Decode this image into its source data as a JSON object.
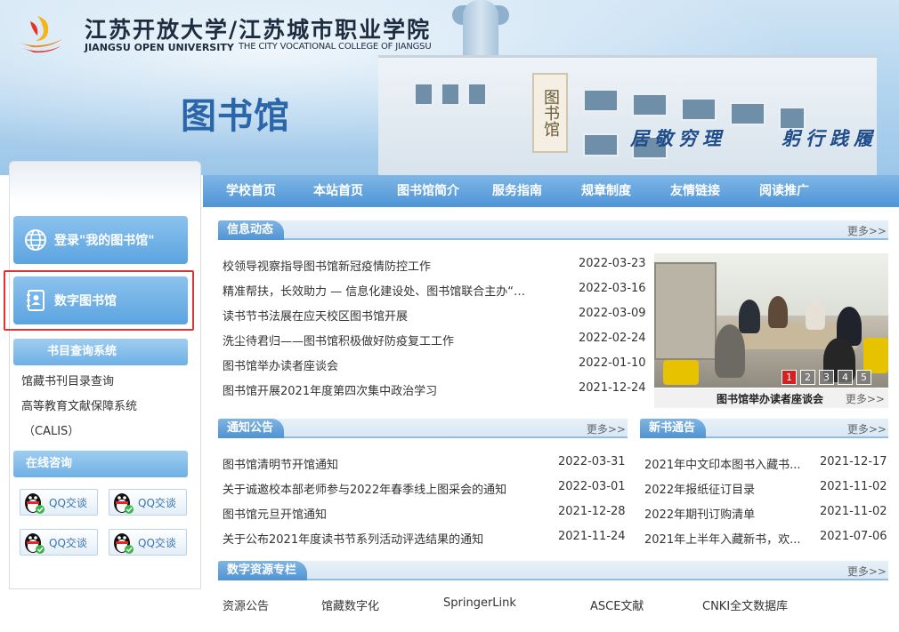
{
  "header": {
    "school_cn": "江苏开放大学/江苏城市职业学院",
    "school_en_1": "JIANGSU OPEN UNIVERSITY",
    "school_en_2": "THE CITY VOCATIONAL COLLEGE OF JIANGSU",
    "library_title": "图书馆",
    "motto_left": "居敬穷理",
    "motto_right": "躬行践履",
    "plaque_text": "图书馆"
  },
  "nav": {
    "items": [
      "学校首页",
      "本站首页",
      "图书馆简介",
      "服务指南",
      "规章制度",
      "友情链接",
      "阅读推广"
    ]
  },
  "sidebar": {
    "login_button": "登录\"我的图书馆\"",
    "digital_library_button": "数字图书馆",
    "catalog_heading": "书目查询系统",
    "catalog_links": [
      "馆藏书刊目录查询",
      "高等教育文献保障系统",
      "（CALIS）"
    ],
    "consult_heading": "在线咨询",
    "qq_label": "QQ交谈"
  },
  "news": {
    "title": "信息动态",
    "more": "更多>>",
    "items": [
      {
        "title": "校领导视察指导图书馆新冠疫情防控工作",
        "date": "2022-03-23"
      },
      {
        "title": "精准帮扶，长效助力 — 信息化建设处、图书馆联合主办“…",
        "date": "2022-03-16"
      },
      {
        "title": "读书节书法展在应天校区图书馆开展",
        "date": "2022-03-09"
      },
      {
        "title": "洗尘待君归——图书馆积极做好防疫复工工作",
        "date": "2022-02-24"
      },
      {
        "title": "图书馆举办读者座谈会",
        "date": "2022-01-10"
      },
      {
        "title": "图书馆开展2021年度第四次集中政治学习",
        "date": "2021-12-24"
      }
    ],
    "photo_caption": "图书馆举办读者座谈会",
    "photo_more": "更多>>",
    "slides": [
      "1",
      "2",
      "3",
      "4",
      "5"
    ]
  },
  "notices": {
    "title": "通知公告",
    "more": "更多>>",
    "items": [
      {
        "title": "图书馆清明节开馆通知",
        "date": "2022-03-31"
      },
      {
        "title": "关于诚邀校本部老师参与2022年春季线上图采会的通知",
        "date": "2022-03-01"
      },
      {
        "title": "图书馆元旦开馆通知",
        "date": "2021-12-28"
      },
      {
        "title": "关于公布2021年度读书节系列活动评选结果的通知",
        "date": "2021-11-24"
      }
    ]
  },
  "new_books": {
    "title": "新书通告",
    "more": "更多>>",
    "items": [
      {
        "title": "2021年中文印本图书入藏书...",
        "date": "2021-12-17"
      },
      {
        "title": "2022年报纸征订目录",
        "date": "2021-11-02"
      },
      {
        "title": "2022年期刊订购清单",
        "date": "2021-11-02"
      },
      {
        "title": "2021年上半年入藏新书，欢...",
        "date": "2021-07-06"
      }
    ]
  },
  "resources": {
    "title": "数字资源专栏",
    "more": "更多>>",
    "items": [
      "资源公告",
      "馆藏数字化",
      "SpringerLink",
      "ASCE文献",
      "CNKI全文数据库"
    ]
  },
  "colors": {
    "nav_blue": "#4e95d6",
    "title_blue": "#2a66a8",
    "highlight_red": "#e23232"
  }
}
